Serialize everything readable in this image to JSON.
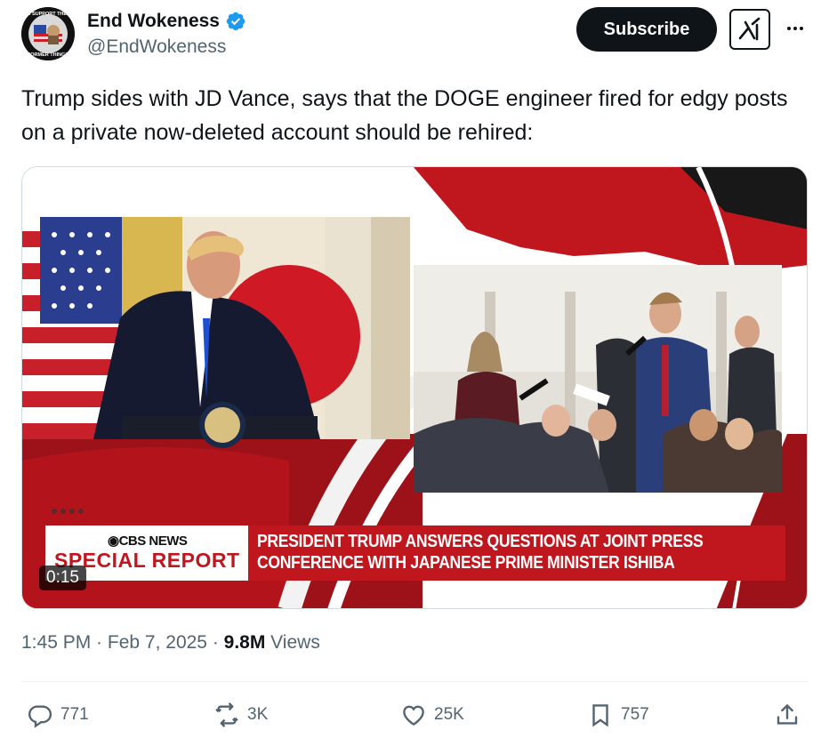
{
  "author": {
    "display_name": "End Wokeness",
    "handle": "@EndWokeness",
    "avatar_text": "I SUPPORT THE FORMER THINGS"
  },
  "header": {
    "subscribe_label": "Subscribe"
  },
  "tweet": {
    "text": "Trump sides with JD Vance, says that the DOGE engineer fired for edgy posts on a private now-deleted account should be rehired:"
  },
  "video": {
    "network": "CBS NEWS",
    "special_report": "SPECIAL REPORT",
    "headline_line1": "PRESIDENT TRUMP ANSWERS QUESTIONS AT JOINT PRESS",
    "headline_line2": "CONFERENCE WITH JAPANESE PRIME MINISTER ISHIBA",
    "duration": "0:15"
  },
  "meta": {
    "time": "1:45 PM",
    "date": "Feb 7, 2025",
    "separator": " · ",
    "views_count": "9.8M",
    "views_label": " Views"
  },
  "actions": {
    "replies": "771",
    "reposts": "3K",
    "likes": "25K",
    "bookmarks": "757"
  },
  "icons": [
    "verified-icon",
    "grok-icon",
    "more-icon",
    "reply-icon",
    "repost-icon",
    "like-icon",
    "bookmark-icon",
    "share-icon"
  ],
  "colors": {
    "verified": "#1d9bf0",
    "text_primary": "#0f1419",
    "text_secondary": "#536471",
    "cbs_red": "#c0161e"
  }
}
